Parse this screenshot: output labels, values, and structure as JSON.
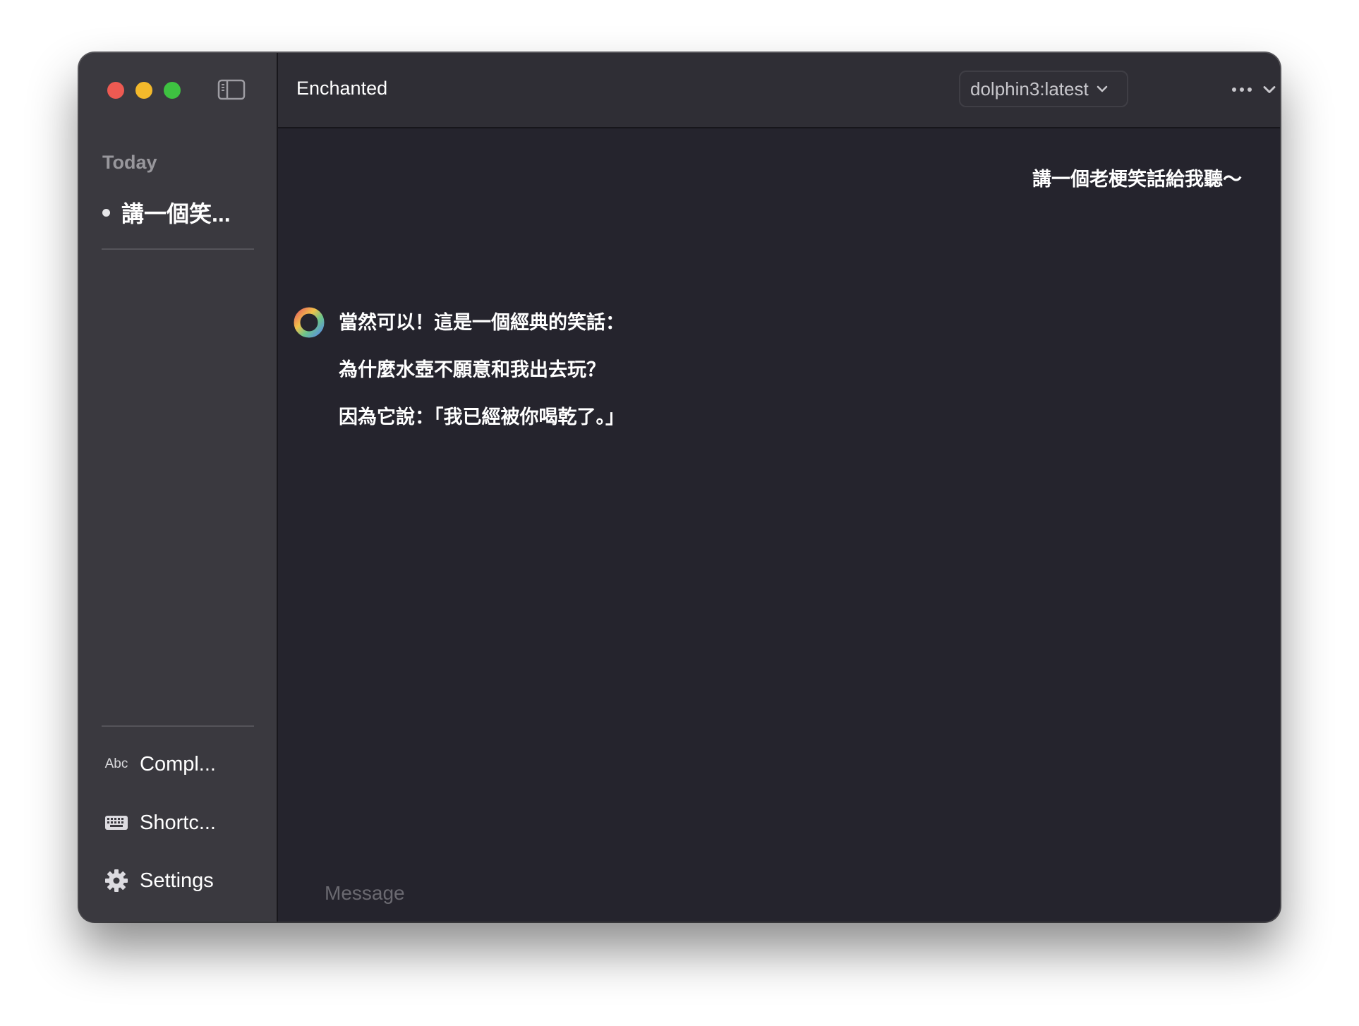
{
  "window": {
    "app_title": "Enchanted"
  },
  "sidebar": {
    "section_label": "Today",
    "conversations": [
      {
        "label": "講一個笑..."
      }
    ],
    "bottom_items": [
      {
        "label": "Compl...",
        "icon": "abc-icon",
        "icon_text": "Abc"
      },
      {
        "label": "Shortc...",
        "icon": "keyboard-icon"
      },
      {
        "label": "Settings",
        "icon": "gear-icon"
      }
    ]
  },
  "toolbar": {
    "model": "dolphin3:latest",
    "more_icon": "ellipsis-icon",
    "compose_icon": "compose-icon"
  },
  "chat": {
    "user_message": "講一個老梗笑話給我聽～",
    "assistant_lines": [
      "當然可以！這是一個經典的笑話：",
      "為什麼水壺不願意和我出去玩？",
      "因為它說：「我已經被你喝乾了。」"
    ]
  },
  "input": {
    "placeholder": "Message",
    "value": ""
  },
  "colors": {
    "close": "#ed5a52",
    "minimize": "#f3b92b",
    "maximize": "#3ec241",
    "sidebar_bg": "#3a393f",
    "chat_bg": "#25242d",
    "toolbar_bg": "#2f2e35"
  }
}
